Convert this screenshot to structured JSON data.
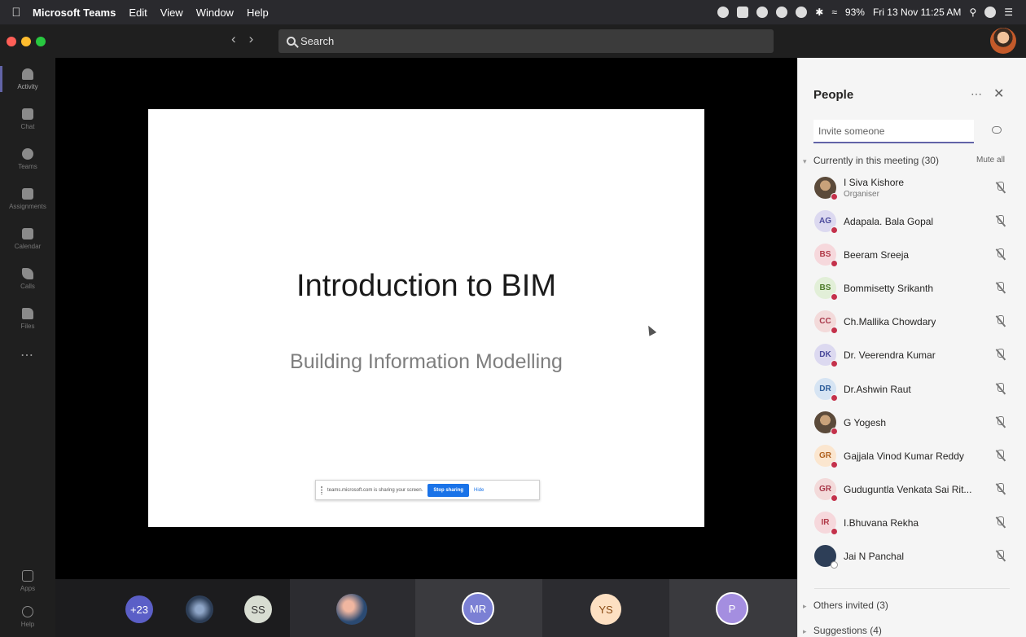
{
  "menubar": {
    "app": "Microsoft Teams",
    "menus": [
      "Edit",
      "View",
      "Window",
      "Help"
    ],
    "battery": "93%",
    "datetime": "Fri 13 Nov  11:25 AM"
  },
  "search": {
    "placeholder": "Search"
  },
  "rail": {
    "items": [
      "Activity",
      "Chat",
      "Teams",
      "Assignments",
      "Calendar",
      "Calls",
      "Files"
    ],
    "bottom": [
      "Apps",
      "Help"
    ]
  },
  "slide": {
    "title": "Introduction to BIM",
    "subtitle": "Building Information Modelling"
  },
  "share_bar": {
    "message": "teams.microsoft.com is sharing your screen.",
    "stop": "Stop sharing",
    "hide": "Hide"
  },
  "tray": {
    "overflow": "+23",
    "tiles": [
      "SS",
      "MR",
      "YS",
      "P"
    ]
  },
  "people": {
    "title": "People",
    "invite_placeholder": "Invite someone",
    "current_section": "Currently in this meeting (30)",
    "mute_all": "Mute all",
    "participants": [
      {
        "initials": "",
        "name": "I Siva Kishore",
        "role": "Organiser",
        "bg": "#8a6a4c",
        "fg": "#ffffff"
      },
      {
        "initials": "AG",
        "name": "Adapala. Bala Gopal",
        "role": "",
        "bg": "#dcd9f0",
        "fg": "#4b4a9c"
      },
      {
        "initials": "BS",
        "name": "Beeram Sreeja",
        "role": "",
        "bg": "#f6d8dc",
        "fg": "#b03a48"
      },
      {
        "initials": "BS",
        "name": "Bommisetty Srikanth",
        "role": "",
        "bg": "#e2efd8",
        "fg": "#4c7a28"
      },
      {
        "initials": "CC",
        "name": "Ch.Mallika Chowdary",
        "role": "",
        "bg": "#f3dada",
        "fg": "#a8384a"
      },
      {
        "initials": "DK",
        "name": "Dr. Veerendra Kumar",
        "role": "",
        "bg": "#dcd9f0",
        "fg": "#4b4a9c"
      },
      {
        "initials": "DR",
        "name": "Dr.Ashwin Raut",
        "role": "",
        "bg": "#d6e4f3",
        "fg": "#2c5d9a"
      },
      {
        "initials": "",
        "name": "G Yogesh",
        "role": "",
        "bg": "#6d7a5a",
        "fg": "#ffffff"
      },
      {
        "initials": "GR",
        "name": "Gajjala Vinod Kumar Reddy",
        "role": "",
        "bg": "#fbe6cf",
        "fg": "#b0611f"
      },
      {
        "initials": "GR",
        "name": "Guduguntla Venkata Sai Rit...",
        "role": "",
        "bg": "#f3dada",
        "fg": "#a8384a"
      },
      {
        "initials": "IR",
        "name": "I.Bhuvana Rekha",
        "role": "",
        "bg": "#f6d8dc",
        "fg": "#b03a48"
      },
      {
        "initials": "",
        "name": "Jai N Panchal",
        "role": "",
        "bg": "#2d3e57",
        "fg": "#ffffff"
      }
    ],
    "others_invited": "Others invited (3)",
    "suggestions": "Suggestions (4)"
  },
  "colors": {
    "accent": "#6264a7",
    "mute_dot": "#c4314b",
    "stop_button": "#1a73e8"
  }
}
